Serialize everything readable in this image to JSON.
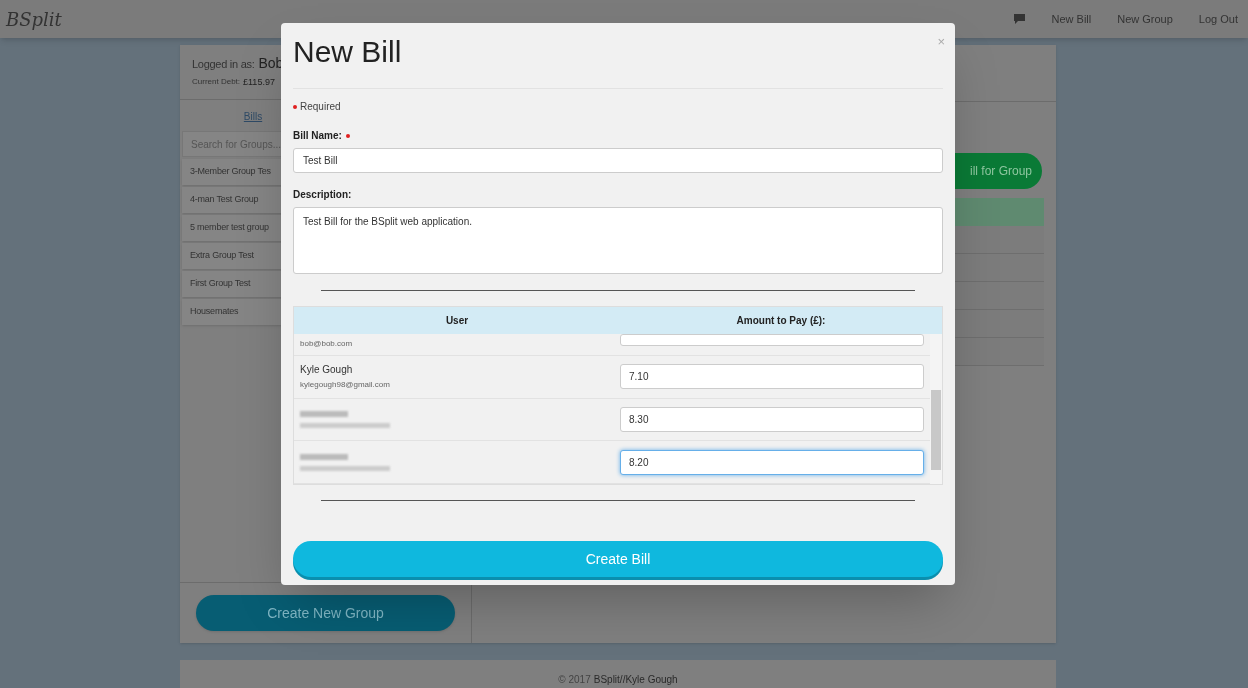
{
  "navbar": {
    "brand": "BSplit",
    "links": [
      "New Bill",
      "New Group",
      "Log Out"
    ]
  },
  "sidebar": {
    "logged_in_label": "Logged in as:",
    "user": "Bob",
    "debt_label": "Current Debt:",
    "debt": "£115.97",
    "tab": "Bills",
    "search": {
      "placeholder": "Search for Groups..."
    },
    "groups": [
      "3-Member Group Tes",
      "4-man Test Group",
      "5 member test group",
      "Extra Group Test",
      "First Group Test",
      "Housemates"
    ],
    "create_button": "Create New Group"
  },
  "main": {
    "bill_button": "ill for Group"
  },
  "footer": {
    "copyright": "© 2017",
    "credit": "BSplit//Kyle Gough"
  },
  "modal": {
    "title": "New Bill",
    "close": "×",
    "required_note": "Required",
    "fields": [
      {
        "label": "Bill Name:",
        "required": true,
        "kind": "input",
        "value": "Test Bill"
      },
      {
        "label": "Description:",
        "required": false,
        "kind": "textarea",
        "value": "Test Bill for the BSplit web application."
      }
    ],
    "table": {
      "columns": [
        "User",
        "Amount to Pay (£):"
      ],
      "rows": [
        {
          "kind": "cut",
          "email": "bob@bob.com",
          "focused": false
        },
        {
          "kind": "visible",
          "name": "Kyle Gough",
          "email": "kylegough98@gmail.com",
          "amount": "7.10",
          "focused": false
        },
        {
          "kind": "blurred",
          "amount": "8.30",
          "focused": false
        },
        {
          "kind": "blurred",
          "amount": "8.20",
          "focused": true
        }
      ]
    },
    "submit": "Create Bill"
  }
}
